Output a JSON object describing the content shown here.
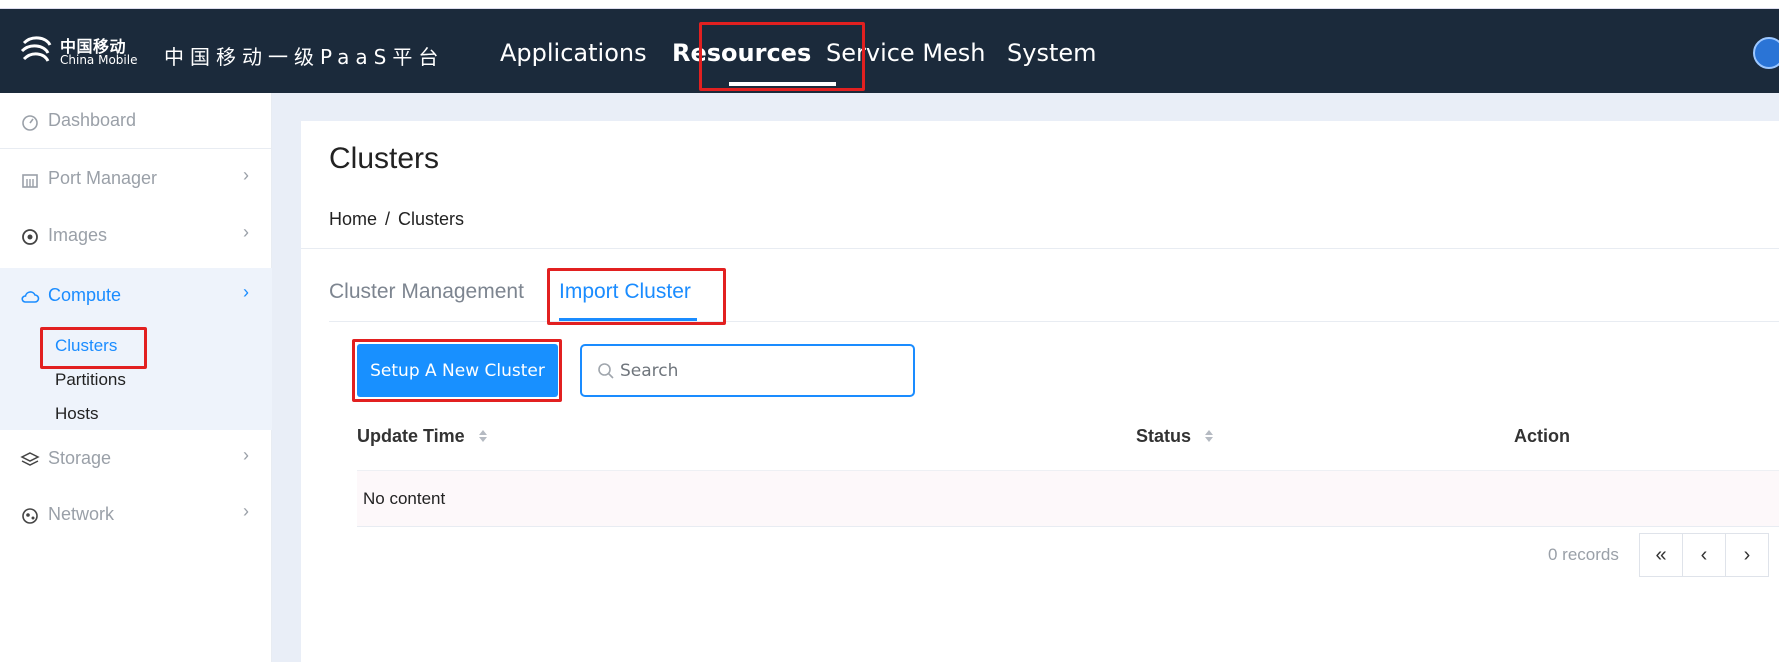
{
  "header": {
    "logo_cn": "中国移动",
    "logo_en": "China Mobile",
    "platform_title": "中国移动一级PaaS平台",
    "nav": [
      {
        "label": "Applications",
        "active": false
      },
      {
        "label": "Resources",
        "active": true
      },
      {
        "label": "Service Mesh",
        "active": false
      },
      {
        "label": "System",
        "active": false
      }
    ]
  },
  "sidebar": {
    "items": [
      {
        "label": "Dashboard",
        "icon": "dashboard-icon"
      },
      {
        "label": "Port Manager",
        "icon": "building-icon"
      },
      {
        "label": "Images",
        "icon": "target-icon"
      },
      {
        "label": "Compute",
        "icon": "cloud-icon",
        "active": true
      },
      {
        "label": "Storage",
        "icon": "layers-icon"
      },
      {
        "label": "Network",
        "icon": "network-icon"
      }
    ],
    "compute_sub": [
      "Clusters",
      "Partitions",
      "Hosts"
    ]
  },
  "page": {
    "title": "Clusters",
    "breadcrumb": [
      "Home",
      "/",
      "Clusters"
    ]
  },
  "tabs": [
    {
      "label": "Cluster Management",
      "active": false
    },
    {
      "label": "Import Cluster",
      "active": true
    }
  ],
  "toolbar": {
    "setup_button": "Setup A New Cluster",
    "search_placeholder": "Search"
  },
  "table": {
    "columns": [
      "Update Time",
      "Status",
      "Action"
    ],
    "empty_text": "No content"
  },
  "pagination": {
    "records": "0 records",
    "buttons": [
      "«",
      "‹",
      "›"
    ]
  },
  "colors": {
    "header_bg": "#1b2a3b",
    "accent": "#1890ff",
    "annotation": "#e22020"
  }
}
